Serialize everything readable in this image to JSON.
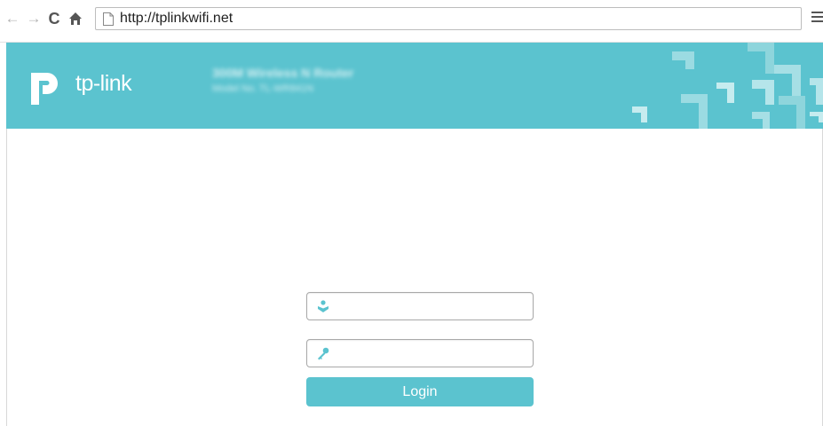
{
  "browser": {
    "back_icon": "back-arrow-icon",
    "forward_icon": "forward-arrow-icon",
    "reload_icon": "reload-icon",
    "home_icon": "home-icon",
    "page_icon": "page-icon",
    "menu_icon": "hamburger-menu-icon",
    "url": "http://tplinkwifi.net"
  },
  "header": {
    "brand": "tp-link",
    "product_title": "300M Wireless N Router",
    "model": "Model No. TL-WR841N",
    "accent_color": "#5bc3cf"
  },
  "login": {
    "username_value": "",
    "password_value": "",
    "username_icon": "user-icon",
    "password_icon": "key-icon",
    "button_label": "Login"
  }
}
